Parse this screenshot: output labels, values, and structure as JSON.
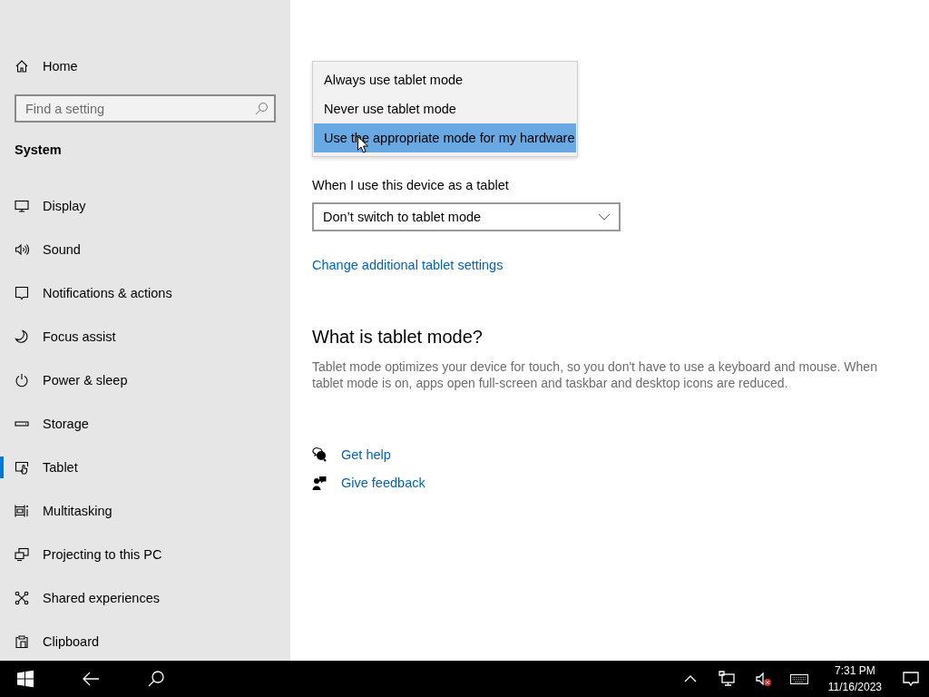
{
  "sidebar": {
    "home": "Home",
    "search": {
      "placeholder": "Find a setting"
    },
    "section": "System",
    "items": [
      {
        "label": "Display",
        "kind": "display",
        "selected": false
      },
      {
        "label": "Sound",
        "kind": "sound",
        "selected": false
      },
      {
        "label": "Notifications & actions",
        "kind": "notifications",
        "selected": false
      },
      {
        "label": "Focus assist",
        "kind": "focus",
        "selected": false
      },
      {
        "label": "Power & sleep",
        "kind": "power",
        "selected": false
      },
      {
        "label": "Storage",
        "kind": "storage",
        "selected": false
      },
      {
        "label": "Tablet",
        "kind": "tablet",
        "selected": true
      },
      {
        "label": "Multitasking",
        "kind": "multitasking",
        "selected": false
      },
      {
        "label": "Projecting to this PC",
        "kind": "projecting",
        "selected": false
      },
      {
        "label": "Shared experiences",
        "kind": "shared",
        "selected": false
      },
      {
        "label": "Clipboard",
        "kind": "clipboard",
        "selected": false
      }
    ]
  },
  "main": {
    "mode_menu": {
      "options": [
        {
          "label": "Always use tablet mode",
          "selected": false
        },
        {
          "label": "Never use tablet mode",
          "selected": false
        },
        {
          "label": "Use the appropriate mode for my hardware",
          "selected": true
        }
      ]
    },
    "device_setting": {
      "label": "When I use this device as a tablet",
      "value": "Don’t switch to tablet mode"
    },
    "link": "Change additional tablet settings",
    "about": {
      "heading": "What is tablet mode?",
      "text": "Tablet mode optimizes your device for touch, so you don't have to use a keyboard and mouse. When tablet mode is on, apps open full-screen and taskbar and desktop icons are reduced."
    },
    "help_links": [
      {
        "label": "Get help",
        "kind": "help"
      },
      {
        "label": "Give feedback",
        "kind": "feedback"
      }
    ]
  },
  "taskbar": {
    "time": "7:31 PM",
    "date": "11/16/2023"
  }
}
